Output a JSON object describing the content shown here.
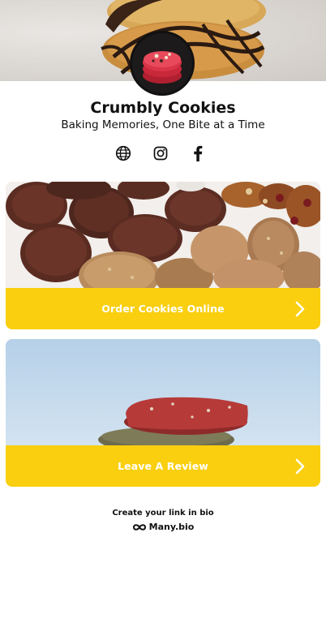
{
  "profile": {
    "name": "Crumbly Cookies",
    "tagline": "Baking Memories, One Bite at a Time"
  },
  "socials": [
    {
      "icon": "globe-icon"
    },
    {
      "icon": "instagram-icon"
    },
    {
      "icon": "facebook-icon"
    }
  ],
  "links": [
    {
      "label": "Order Cookies Online",
      "icon": "chevron-right-icon"
    },
    {
      "label": "Leave A Review",
      "icon": "chevron-right-icon"
    }
  ],
  "footer": {
    "cta": "Create your link in bio",
    "brand": "Many.bio",
    "brand_icon": "infinity-icon"
  },
  "colors": {
    "button": "#f9cf0f",
    "button_text": "#ffffff",
    "text": "#111111"
  }
}
